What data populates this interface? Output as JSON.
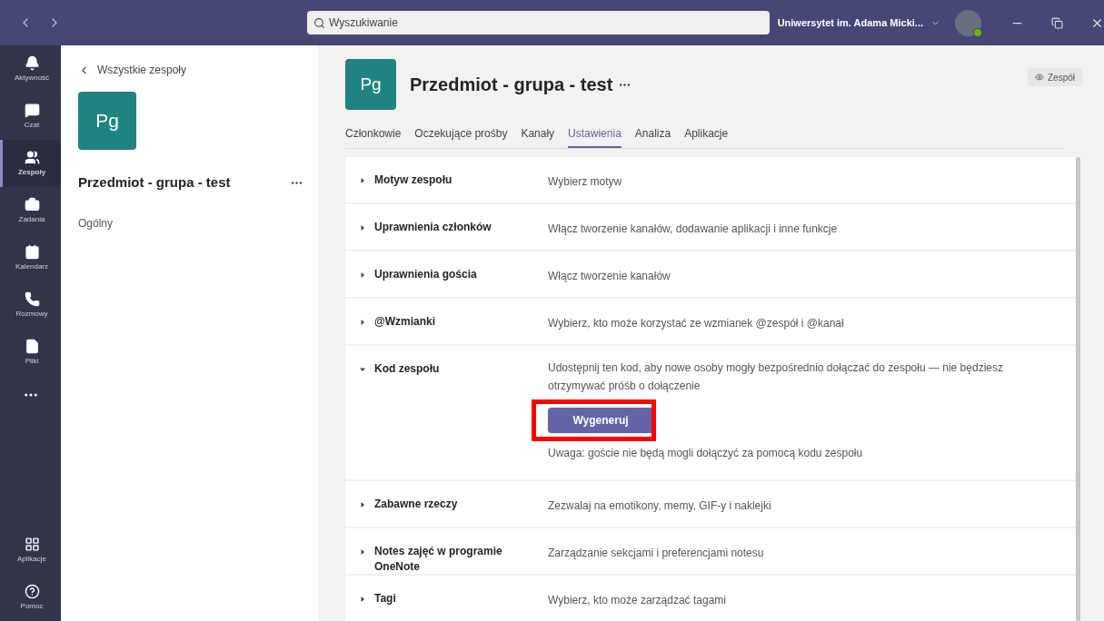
{
  "search": {
    "placeholder": "Wyszukiwanie"
  },
  "account": {
    "org": "Uniwersytet im. Adama Micki..."
  },
  "rail": [
    {
      "label": "Aktywność",
      "selected": false
    },
    {
      "label": "Czat",
      "selected": false
    },
    {
      "label": "Zespoły",
      "selected": true
    },
    {
      "label": "Zadania",
      "selected": false
    },
    {
      "label": "Kalendarz",
      "selected": false
    },
    {
      "label": "Rozmowy",
      "selected": false
    },
    {
      "label": "Pliki",
      "selected": false
    }
  ],
  "rail_bottom": [
    {
      "label": "Aplikacje"
    },
    {
      "label": "Pomoc"
    }
  ],
  "team_panel": {
    "back": "Wszystkie zespoły",
    "avatar": "Pg",
    "name": "Przedmiot - grupa - test",
    "channels": [
      "Ogólny"
    ]
  },
  "header": {
    "avatar": "Pg",
    "title": "Przedmiot - grupa - test",
    "badge": "Zespół"
  },
  "tabs": [
    {
      "label": "Członkowie",
      "selected": false
    },
    {
      "label": "Oczekujące prośby",
      "selected": false
    },
    {
      "label": "Kanały",
      "selected": false
    },
    {
      "label": "Ustawienia",
      "selected": true
    },
    {
      "label": "Analiza",
      "selected": false
    },
    {
      "label": "Aplikacje",
      "selected": false
    }
  ],
  "settings": [
    {
      "kind": "simple",
      "title": "Motyw zespołu",
      "expanded": false,
      "description": "Wybierz motyw"
    },
    {
      "kind": "simple",
      "title": "Uprawnienia członków",
      "expanded": false,
      "description": "Włącz tworzenie kanałów, dodawanie aplikacji i inne funkcje"
    },
    {
      "kind": "simple",
      "title": "Uprawnienia gościa",
      "expanded": false,
      "description": "Włącz tworzenie kanałów"
    },
    {
      "kind": "simple",
      "title": "@Wzmianki",
      "expanded": false,
      "description": "Wybierz, kto może korzystać ze wzmianek @zespół i @kanał"
    },
    {
      "kind": "code",
      "title": "Kod zespołu",
      "expanded": true,
      "description": "Udostępnij ten kod, aby nowe osoby mogły bezpośrednio dołączać do zespołu — nie będziesz otrzymywać próśb o dołączenie",
      "button": "Wygeneruj",
      "note": "Uwaga: goście nie będą mogli dołączyć za pomocą kodu zespołu"
    },
    {
      "kind": "simple",
      "title": "Zabawne rzeczy",
      "expanded": false,
      "description": "Zezwalaj na emotikony, memy, GIF-y i naklejki"
    },
    {
      "kind": "simple",
      "title": "Notes zajęć w programie OneNote",
      "expanded": false,
      "description": "Zarządzanie sekcjami i preferencjami notesu"
    },
    {
      "kind": "simple",
      "title": "Tagi",
      "expanded": false,
      "description": "Wybierz, kto może zarządzać tagami"
    }
  ]
}
